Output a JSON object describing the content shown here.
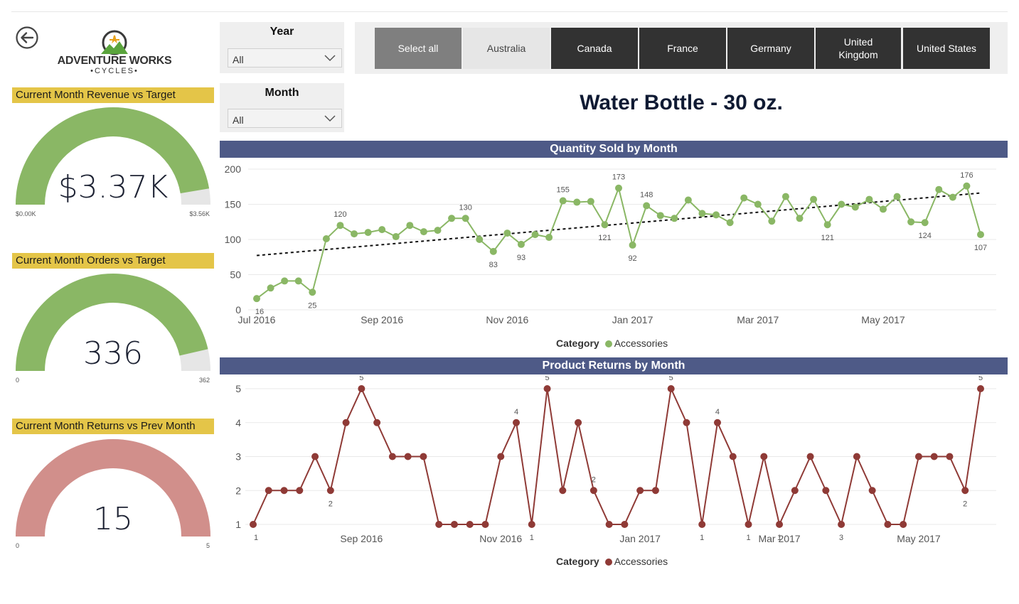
{
  "header": {
    "logo_text": "ADVENTURE WORKS",
    "logo_sub": "•CYCLES•"
  },
  "slicers": {
    "year": {
      "label": "Year",
      "value": "All"
    },
    "month": {
      "label": "Month",
      "value": "All"
    }
  },
  "countries": [
    {
      "label": "Select all",
      "state": "select-all"
    },
    {
      "label": "Australia",
      "state": "selected"
    },
    {
      "label": "Canada",
      "state": "unselected"
    },
    {
      "label": "France",
      "state": "unselected"
    },
    {
      "label": "Germany",
      "state": "unselected"
    },
    {
      "label": "United Kingdom",
      "state": "unselected"
    },
    {
      "label": "United States",
      "state": "unselected"
    }
  ],
  "product_title": "Water Bottle - 30 oz.",
  "kpis": {
    "revenue": {
      "title": "Current Month Revenue vs Target",
      "value": "$3.37K",
      "min": "$0.00K",
      "max": "$3.56K",
      "fraction": 0.947,
      "color": "#8ab765"
    },
    "orders": {
      "title": "Current Month Orders vs Target",
      "value": "336",
      "min": "0",
      "max": "362",
      "fraction": 0.928,
      "color": "#8ab765"
    },
    "returns": {
      "title": "Current Month Returns vs Prev Month",
      "value": "15",
      "min": "0",
      "max": "5",
      "fraction": 1.0,
      "color": "#d18f8b"
    }
  },
  "chart_data": [
    {
      "type": "line",
      "title": "Quantity Sold by Month",
      "ylim": [
        0,
        200
      ],
      "yticks": [
        0,
        50,
        100,
        150,
        200
      ],
      "x_tick_labels": [
        "Jul 2016",
        "Sep 2016",
        "Nov 2016",
        "Jan 2017",
        "Mar 2017",
        "May 2017"
      ],
      "x_tick_index": [
        0,
        9,
        18,
        27,
        36,
        45
      ],
      "legend_title": "Category",
      "color": "#8ab765",
      "trendline": true,
      "series": [
        {
          "name": "Accessories",
          "values": [
            16,
            31,
            41,
            41,
            25,
            101,
            120,
            108,
            110,
            114,
            104,
            120,
            111,
            113,
            130,
            130,
            100,
            83,
            109,
            93,
            107,
            103,
            155,
            153,
            154,
            121,
            173,
            92,
            148,
            134,
            130,
            156,
            137,
            135,
            124,
            159,
            150,
            126,
            161,
            130,
            157,
            121,
            150,
            146,
            157,
            143,
            161,
            125,
            124,
            171,
            160,
            176,
            107
          ]
        }
      ],
      "data_labels": [
        {
          "index": 0,
          "text": "16"
        },
        {
          "index": 4,
          "text": "25"
        },
        {
          "index": 6,
          "text": "120"
        },
        {
          "index": 15,
          "text": "130"
        },
        {
          "index": 17,
          "text": "83"
        },
        {
          "index": 19,
          "text": "93"
        },
        {
          "index": 22,
          "text": "155"
        },
        {
          "index": 25,
          "text": "121"
        },
        {
          "index": 26,
          "text": "173"
        },
        {
          "index": 27,
          "text": "92"
        },
        {
          "index": 28,
          "text": "148"
        },
        {
          "index": 41,
          "text": "121"
        },
        {
          "index": 48,
          "text": "124"
        },
        {
          "index": 51,
          "text": "176"
        },
        {
          "index": 52,
          "text": "107"
        }
      ]
    },
    {
      "type": "line",
      "title": "Product Returns by Month",
      "ylim": [
        1,
        5
      ],
      "yticks": [
        1,
        2,
        3,
        4,
        5
      ],
      "x_tick_labels": [
        "Sep 2016",
        "Nov 2016",
        "Jan 2017",
        "Mar 2017",
        "May 2017"
      ],
      "x_tick_index": [
        7,
        16,
        25,
        34,
        43
      ],
      "legend_title": "Category",
      "color": "#8f3a36",
      "trendline": false,
      "series": [
        {
          "name": "Accessories",
          "values": [
            1,
            2,
            2,
            2,
            3,
            2,
            4,
            5,
            4,
            3,
            3,
            3,
            1,
            1,
            1,
            1,
            3,
            4,
            1,
            5,
            2,
            4,
            2,
            1,
            1,
            2,
            2,
            5,
            4,
            1,
            4,
            3,
            1,
            3,
            1,
            2,
            3,
            2,
            1,
            3,
            2,
            1,
            1,
            3,
            3,
            3,
            2,
            5
          ]
        }
      ],
      "data_labels": [
        {
          "index": 0,
          "text": "1"
        },
        {
          "index": 5,
          "text": "2"
        },
        {
          "index": 7,
          "text": "5"
        },
        {
          "index": 17,
          "text": "4"
        },
        {
          "index": 18,
          "text": "1"
        },
        {
          "index": 19,
          "text": "5"
        },
        {
          "index": 22,
          "text": "2"
        },
        {
          "index": 27,
          "text": "5"
        },
        {
          "index": 29,
          "text": "1"
        },
        {
          "index": 30,
          "text": "4"
        },
        {
          "index": 32,
          "text": "1"
        },
        {
          "index": 34,
          "text": "1"
        },
        {
          "index": 38,
          "text": "3"
        },
        {
          "index": 46,
          "text": "2"
        },
        {
          "index": 47,
          "text": "5"
        }
      ]
    }
  ]
}
